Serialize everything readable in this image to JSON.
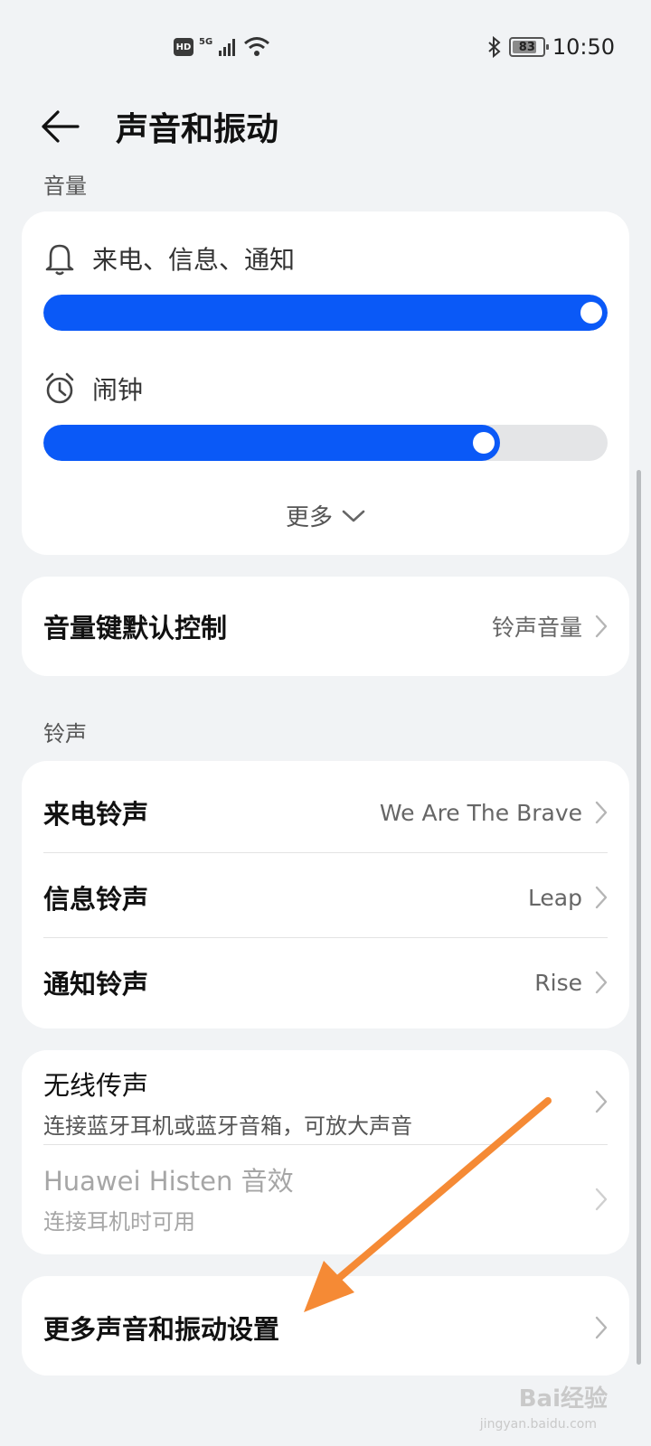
{
  "status_bar": {
    "hd_label": "HD",
    "network_label": "5G",
    "battery_level": 83,
    "battery_text": "83",
    "time": "10:50"
  },
  "header": {
    "back_icon": "arrow-left-icon",
    "title": "声音和振动"
  },
  "volume_section": {
    "label": "音量",
    "items": [
      {
        "icon": "bell-icon",
        "label": "来电、信息、通知",
        "level": 1.0
      },
      {
        "icon": "alarm-clock-icon",
        "label": "闹钟",
        "level": 0.81
      }
    ],
    "more_label": "更多"
  },
  "volume_key": {
    "label": "音量键默认控制",
    "value": "铃声音量"
  },
  "ringtone_section": {
    "label": "铃声",
    "items": [
      {
        "label": "来电铃声",
        "value": "We Are The Brave"
      },
      {
        "label": "信息铃声",
        "value": "Leap"
      },
      {
        "label": "通知铃声",
        "value": "Rise"
      }
    ]
  },
  "audio_card": {
    "items": [
      {
        "title": "无线传声",
        "subtitle": "连接蓝牙耳机或蓝牙音箱，可放大声音"
      },
      {
        "title": "Huawei Histen 音效",
        "subtitle": "连接耳机时可用"
      }
    ]
  },
  "more_settings": {
    "label": "更多声音和振动设置"
  },
  "colors": {
    "accent": "#0a59f7",
    "background": "#f1f3f5",
    "annotation_arrow": "#f58a35"
  },
  "watermark": {
    "main": "Bai经验",
    "sub": "jingyan.baidu.com"
  }
}
